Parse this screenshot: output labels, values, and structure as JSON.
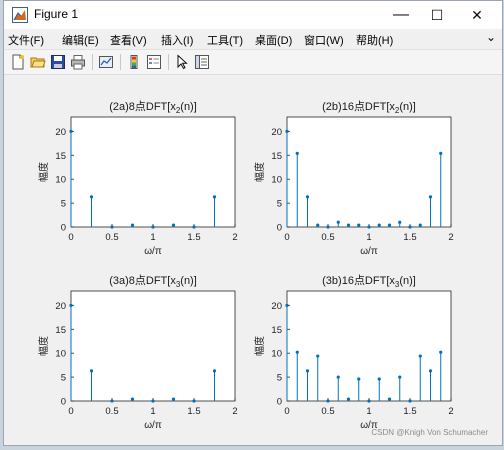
{
  "window": {
    "title": "Figure 1",
    "minimize": "—",
    "maximize": "☐",
    "close": "✕",
    "collapse": "⌄"
  },
  "menu": [
    {
      "label": "文件(F)"
    },
    {
      "label": "编辑(E)"
    },
    {
      "label": "查看(V)"
    },
    {
      "label": "插入(I)"
    },
    {
      "label": "工具(T)"
    },
    {
      "label": "桌面(D)"
    },
    {
      "label": "窗口(W)"
    },
    {
      "label": "帮助(H)"
    }
  ],
  "toolbar": [
    {
      "icon": "new-figure-icon"
    },
    {
      "icon": "open-file-icon"
    },
    {
      "icon": "save-icon"
    },
    {
      "icon": "print-icon"
    },
    {
      "icon": "link-plot-icon"
    },
    {
      "icon": "colorbar-icon"
    },
    {
      "icon": "legend-icon"
    },
    {
      "icon": "edit-pointer-icon"
    },
    {
      "icon": "property-inspector-icon"
    }
  ],
  "colors": {
    "stem": "#0072bd",
    "axes": "#262626"
  },
  "watermark": "CSDN @Knigh Von Schumacher",
  "chart_data": [
    {
      "type": "stem",
      "title": "(2a)8点DFT[x2(n)]",
      "title_main": "(2a)8点DFT[x",
      "title_sub": "2",
      "title_end": "(n)]",
      "xlabel": "ω/π",
      "ylabel": "幅度",
      "xlim": [
        0,
        2
      ],
      "ylim": [
        0,
        23
      ],
      "xticks": [
        0,
        0.5,
        1,
        1.5,
        2
      ],
      "xtick_labels": [
        "0",
        "0.5",
        "1",
        "1.5",
        "2"
      ],
      "yticks": [
        0,
        5,
        10,
        15,
        20
      ],
      "ytick_labels": [
        "0",
        "5",
        "10",
        "15",
        "20"
      ],
      "x": [
        0,
        0.25,
        0.5,
        0.75,
        1,
        1.25,
        1.5,
        1.75
      ],
      "y": [
        20,
        6.3,
        0,
        0.4,
        0,
        0.4,
        0,
        6.3
      ]
    },
    {
      "type": "stem",
      "title": "(2b)16点DFT[x2(n)]",
      "title_main": "(2b)16点DFT[x",
      "title_sub": "2",
      "title_end": "(n)]",
      "xlabel": "ω/π",
      "ylabel": "幅度",
      "xlim": [
        0,
        2
      ],
      "ylim": [
        0,
        23
      ],
      "xticks": [
        0,
        0.5,
        1,
        1.5,
        2
      ],
      "xtick_labels": [
        "0",
        "0.5",
        "1",
        "1.5",
        "2"
      ],
      "yticks": [
        0,
        5,
        10,
        15,
        20
      ],
      "ytick_labels": [
        "0",
        "5",
        "10",
        "15",
        "20"
      ],
      "x": [
        0,
        0.125,
        0.25,
        0.375,
        0.5,
        0.625,
        0.75,
        0.875,
        1,
        1.125,
        1.25,
        1.375,
        1.5,
        1.625,
        1.75,
        1.875
      ],
      "y": [
        20,
        15.4,
        6.3,
        0.4,
        0,
        1.0,
        0.4,
        0.4,
        0,
        0.4,
        0.4,
        1.0,
        0,
        0.4,
        6.3,
        15.4
      ]
    },
    {
      "type": "stem",
      "title": "(3a)8点DFT[x3(n)]",
      "title_main": "(3a)8点DFT[x",
      "title_sub": "3",
      "title_end": "(n)]",
      "xlabel": "ω/π",
      "ylabel": "幅度",
      "xlim": [
        0,
        2
      ],
      "ylim": [
        0,
        23
      ],
      "xticks": [
        0,
        0.5,
        1,
        1.5,
        2
      ],
      "xtick_labels": [
        "0",
        "0.5",
        "1",
        "1.5",
        "2"
      ],
      "yticks": [
        0,
        5,
        10,
        15,
        20
      ],
      "ytick_labels": [
        "0",
        "5",
        "10",
        "15",
        "20"
      ],
      "x": [
        0,
        0.25,
        0.5,
        0.75,
        1,
        1.25,
        1.5,
        1.75
      ],
      "y": [
        20,
        6.3,
        0,
        0.4,
        0,
        0.4,
        0,
        6.3
      ]
    },
    {
      "type": "stem",
      "title": "(3b)16点DFT[x3(n)]",
      "title_main": "(3b)16点DFT[x",
      "title_sub": "3",
      "title_end": "(n)]",
      "xlabel": "ω/π",
      "ylabel": "幅度",
      "xlim": [
        0,
        2
      ],
      "ylim": [
        0,
        23
      ],
      "xticks": [
        0,
        0.5,
        1,
        1.5,
        2
      ],
      "xtick_labels": [
        "0",
        "0.5",
        "1",
        "1.5",
        "2"
      ],
      "yticks": [
        0,
        5,
        10,
        15,
        20
      ],
      "ytick_labels": [
        "0",
        "5",
        "10",
        "15",
        "20"
      ],
      "x": [
        0,
        0.125,
        0.25,
        0.375,
        0.5,
        0.625,
        0.75,
        0.875,
        1,
        1.125,
        1.25,
        1.375,
        1.5,
        1.625,
        1.75,
        1.875
      ],
      "y": [
        20,
        10.2,
        6.3,
        9.4,
        0,
        5.0,
        0.4,
        4.6,
        0,
        4.6,
        0.4,
        5.0,
        0,
        9.4,
        6.3,
        10.2
      ]
    }
  ]
}
